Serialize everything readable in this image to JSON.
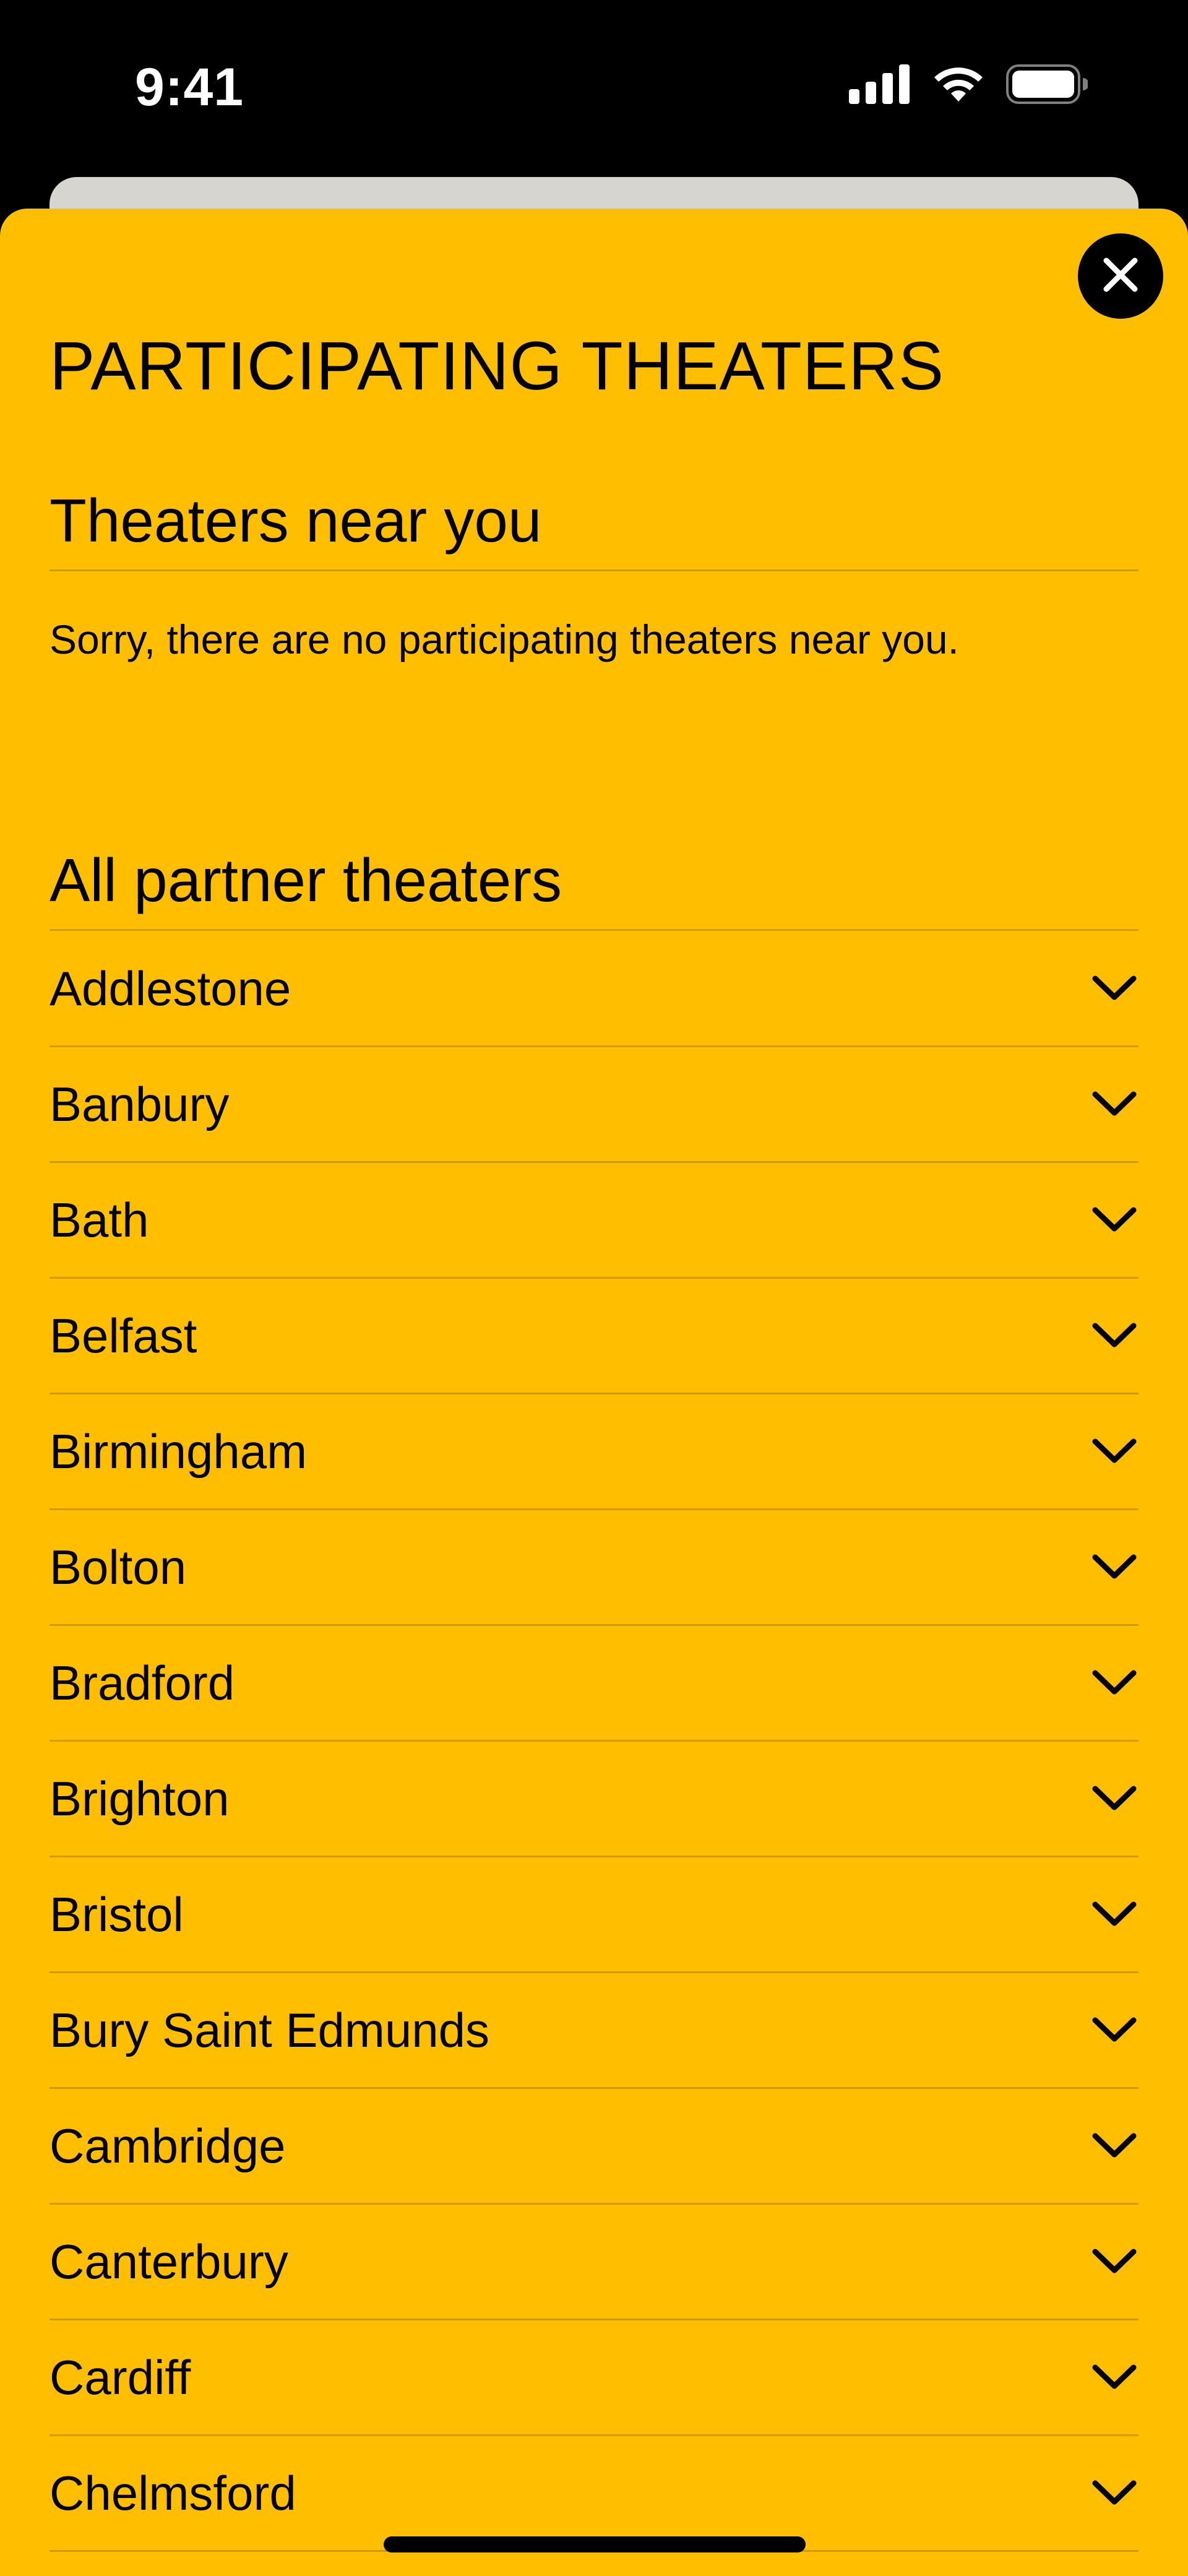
{
  "status_bar": {
    "time": "9:41",
    "icons": [
      "cellular-signal-icon",
      "wifi-icon",
      "battery-icon"
    ]
  },
  "sheet": {
    "background_color": "#ffbe00",
    "title": "PARTICIPATING THEATERS",
    "close_icon": "close-icon"
  },
  "near_you": {
    "heading": "Theaters near you",
    "empty_message": "Sorry, there are no participating theaters near you."
  },
  "partners": {
    "heading": "All partner theaters",
    "expand_icon": "chevron-down-icon",
    "items": [
      {
        "label": "Addlestone"
      },
      {
        "label": "Banbury"
      },
      {
        "label": "Bath"
      },
      {
        "label": "Belfast"
      },
      {
        "label": "Birmingham"
      },
      {
        "label": "Bolton"
      },
      {
        "label": "Bradford"
      },
      {
        "label": "Brighton"
      },
      {
        "label": "Bristol"
      },
      {
        "label": "Bury Saint Edmunds"
      },
      {
        "label": "Cambridge"
      },
      {
        "label": "Canterbury"
      },
      {
        "label": "Cardiff"
      },
      {
        "label": "Chelmsford"
      }
    ]
  }
}
